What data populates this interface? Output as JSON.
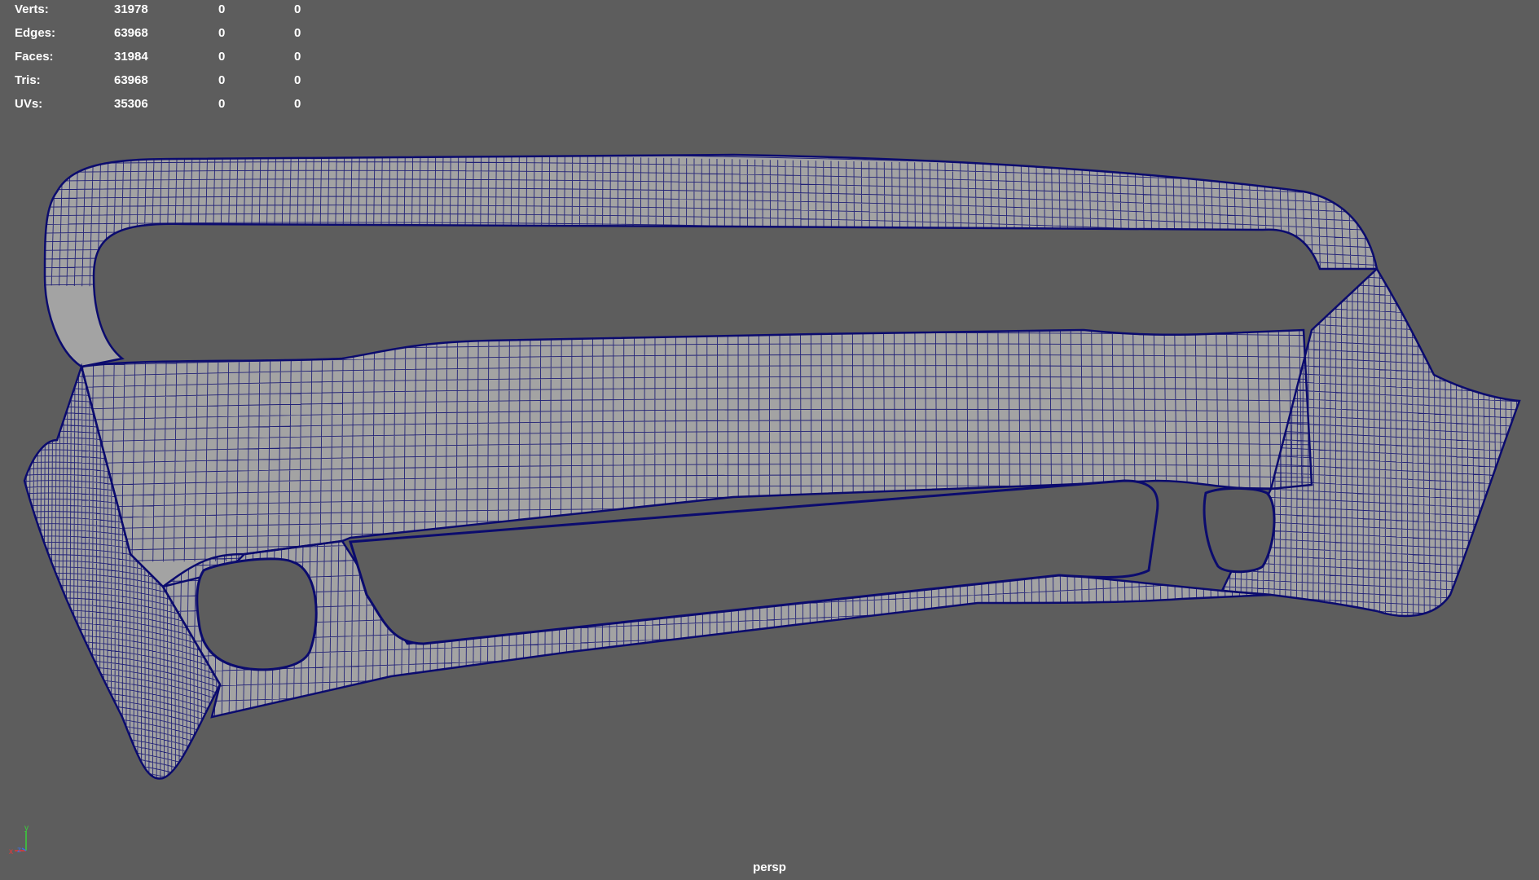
{
  "hud": {
    "rows": [
      {
        "label": "Verts:",
        "v1": "31978",
        "v2": "0",
        "v3": "0"
      },
      {
        "label": "Edges:",
        "v1": "63968",
        "v2": "0",
        "v3": "0"
      },
      {
        "label": "Faces:",
        "v1": "31984",
        "v2": "0",
        "v3": "0"
      },
      {
        "label": "Tris:",
        "v1": "63968",
        "v2": "0",
        "v3": "0"
      },
      {
        "label": "UVs:",
        "v1": "35306",
        "v2": "0",
        "v3": "0"
      }
    ]
  },
  "axis": {
    "x": "x",
    "y": "y",
    "z": "z"
  },
  "camera": {
    "name": "persp"
  },
  "colors": {
    "background": "#5d5d5d",
    "surface": "#a3a3a3",
    "wire": "#0b0b6e",
    "hud_text": "#ffffff",
    "axis_x": "#e23a3a",
    "axis_y": "#3ad23a",
    "axis_z": "#3a6ee2"
  }
}
